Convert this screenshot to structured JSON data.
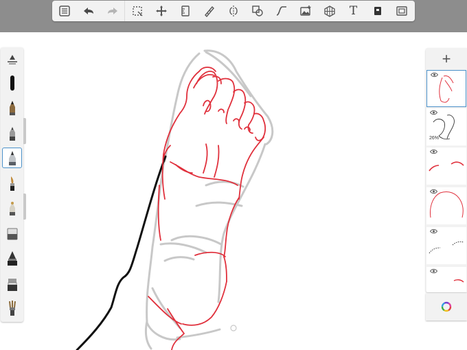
{
  "toolbar": {
    "tools": [
      {
        "name": "lists-icon"
      },
      {
        "name": "undo-icon"
      },
      {
        "name": "redo-icon"
      },
      {
        "name": "selection-icon"
      },
      {
        "name": "transform-icon"
      },
      {
        "name": "ruler-icon"
      },
      {
        "name": "stroke-icon"
      },
      {
        "name": "symmetry-icon"
      },
      {
        "name": "shapes-icon"
      },
      {
        "name": "curve-icon"
      },
      {
        "name": "image-icon"
      },
      {
        "name": "perspective-icon"
      },
      {
        "name": "text-icon"
      },
      {
        "name": "color-fill-icon"
      },
      {
        "name": "fullscreen-icon"
      }
    ],
    "text_tool_glyph": "T"
  },
  "brushes": {
    "items": [
      "resize-brush-icon",
      "brush-preview-icon",
      "pencil-icon",
      "ballpoint-icon",
      "marker-icon",
      "paintbrush-icon",
      "airbrush-icon",
      "eraser-icon",
      "ink-pen-icon",
      "smudge-icon",
      "brush-library-icon"
    ],
    "selected_index": 4
  },
  "layers": {
    "add_label": "+",
    "items": [
      {
        "name": "layer-1",
        "opacity": "",
        "active": true,
        "color": "#e0303c"
      },
      {
        "name": "layer-2",
        "opacity": "26%",
        "active": false,
        "color": "#333333"
      },
      {
        "name": "layer-3",
        "opacity": "",
        "active": false,
        "color": "#e0303c"
      },
      {
        "name": "layer-4",
        "opacity": "",
        "active": false,
        "color": "#e0303c"
      },
      {
        "name": "layer-5",
        "opacity": "",
        "active": false,
        "color": "#333333"
      },
      {
        "name": "layer-6",
        "opacity": "",
        "active": false,
        "color": "#e0303c"
      }
    ]
  },
  "colors": {
    "sketch_red": "#e0303c",
    "sketch_gray": "#c8c8c8",
    "sketch_black": "#111111",
    "selection_blue": "#4a90c8"
  }
}
